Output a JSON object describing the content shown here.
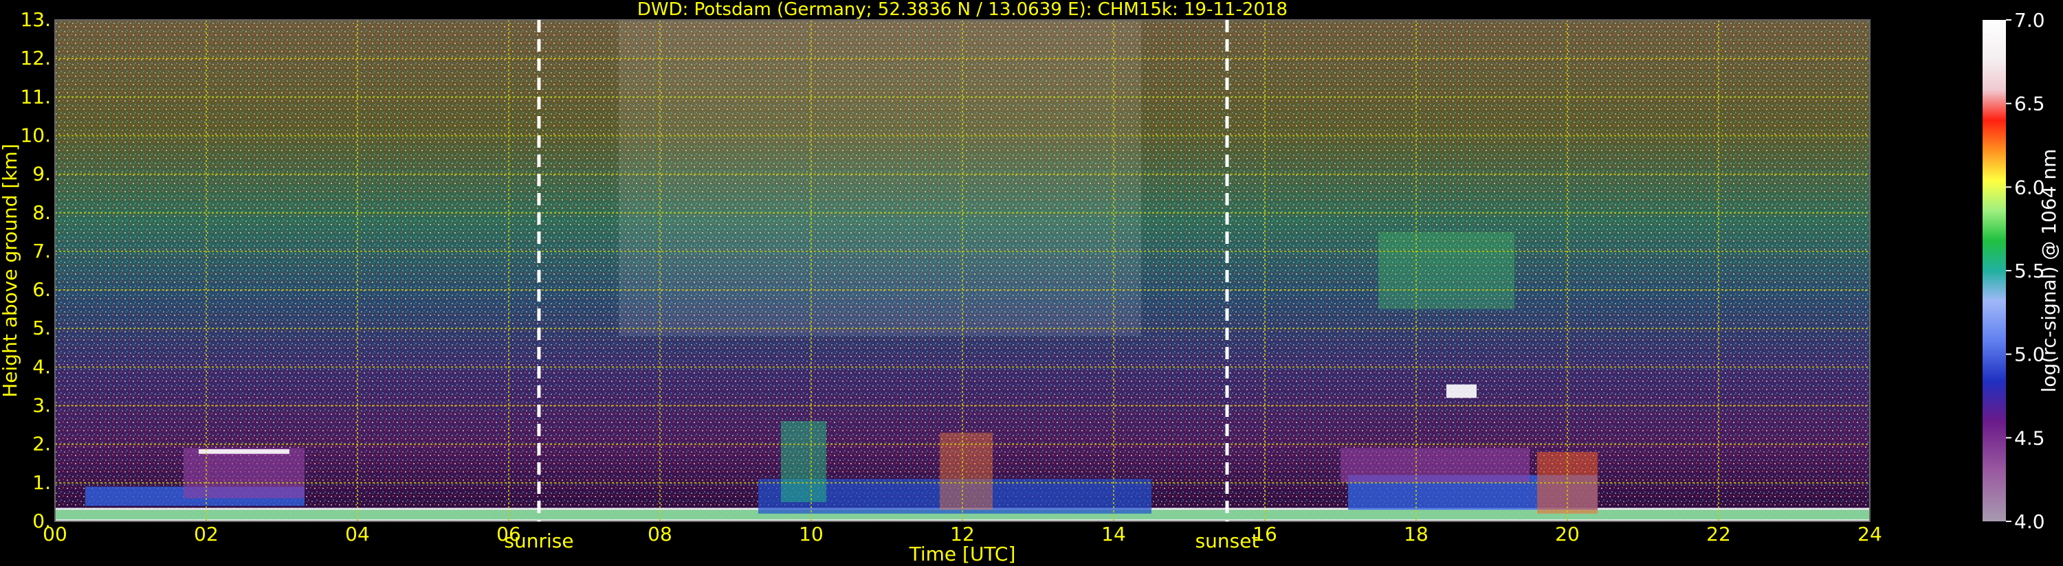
{
  "chart_data": {
    "type": "heatmap",
    "title": "DWD: Potsdam (Germany; 52.3836 N / 13.0639 E):     CHM15k: 19-11-2018",
    "xlabel": "Time [UTC]",
    "ylabel": "Height above ground [km]",
    "x_range": [
      0,
      24
    ],
    "y_range": [
      0,
      13
    ],
    "x_ticks": [
      "00",
      "02",
      "04",
      "06",
      "08",
      "10",
      "12",
      "14",
      "16",
      "18",
      "20",
      "22",
      "24"
    ],
    "y_ticks": [
      "0.",
      "1.",
      "2.",
      "3.",
      "4.",
      "5.",
      "6.",
      "7.",
      "8.",
      "9.",
      "10.",
      "11.",
      "12.",
      "13."
    ],
    "grid": true,
    "markers": [
      {
        "label": "sunrise",
        "x": 6.4
      },
      {
        "label": "sunset",
        "x": 15.5
      }
    ],
    "colorbar": {
      "label": "log(rc-signal) @ 1064 nm",
      "range": [
        4.0,
        7.0
      ],
      "ticks": [
        "4.0",
        "4.5",
        "5.0",
        "5.5",
        "6.0",
        "6.5",
        "7.0"
      ]
    },
    "colors": {
      "grid": "#cccc00",
      "text": "#ffff00",
      "background": "#000000"
    }
  }
}
